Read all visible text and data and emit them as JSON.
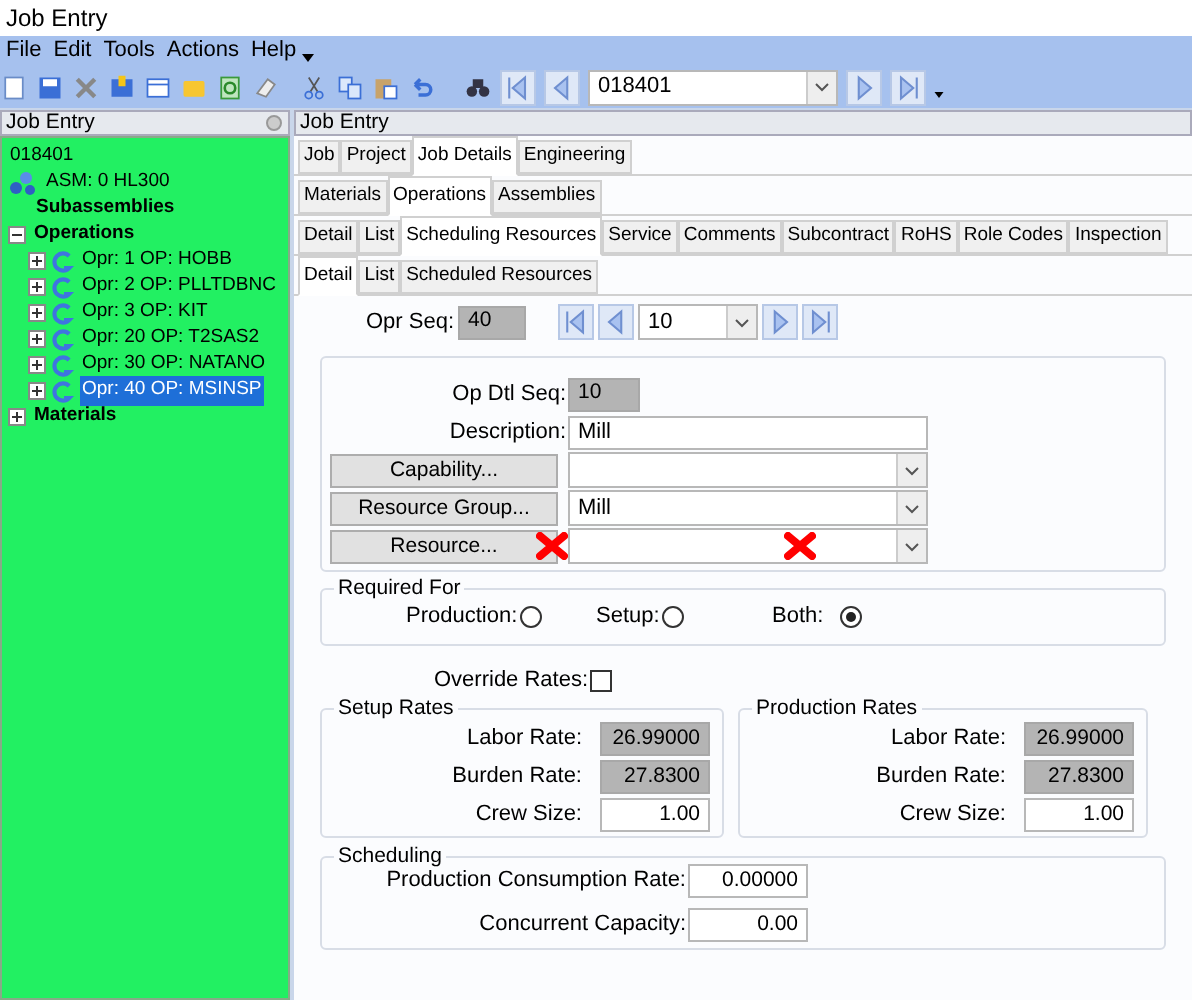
{
  "window": {
    "title": "Job Entry"
  },
  "menu": [
    "File",
    "Edit",
    "Tools",
    "Actions",
    "Help"
  ],
  "toolbar": {
    "record": "018401"
  },
  "tree_panel": {
    "title": "Job Entry",
    "tree": [
      {
        "label": "018401",
        "kind": "root",
        "selected": false,
        "children": [
          {
            "label": "ASM: 0 HL300",
            "kind": "assembly",
            "selected": false
          },
          {
            "label": "Subassemblies",
            "kind": "group",
            "selected": false
          },
          {
            "label": "Operations",
            "kind": "group",
            "expanded": true,
            "selected": false,
            "children": [
              {
                "label": "Opr: 1 OP: HOBB",
                "kind": "operation",
                "expanded": false,
                "selected": false
              },
              {
                "label": "Opr: 2 OP: PLLTDBNC",
                "kind": "operation",
                "expanded": false,
                "selected": false
              },
              {
                "label": "Opr: 3 OP: KIT",
                "kind": "operation",
                "expanded": false,
                "selected": false
              },
              {
                "label": "Opr: 20 OP: T2SAS2",
                "kind": "operation",
                "expanded": false,
                "selected": false
              },
              {
                "label": "Opr: 30 OP: NATANO",
                "kind": "operation",
                "expanded": false,
                "selected": false
              },
              {
                "label": "Opr: 40 OP: MSINSP",
                "kind": "operation",
                "expanded": false,
                "selected": true
              }
            ]
          },
          {
            "label": "Materials",
            "kind": "group",
            "expanded": false,
            "selected": false
          }
        ]
      }
    ]
  },
  "detail_panel": {
    "title": "Job Entry",
    "tab_rows": [
      [
        {
          "label": "Job",
          "selected": false
        },
        {
          "label": "Project",
          "selected": false
        },
        {
          "label": "Job Details",
          "selected": true
        },
        {
          "label": "Engineering",
          "selected": false
        }
      ],
      [
        {
          "label": "Materials",
          "selected": false
        },
        {
          "label": "Operations",
          "selected": true
        },
        {
          "label": "Assemblies",
          "selected": false
        }
      ],
      [
        {
          "label": "Detail",
          "selected": false
        },
        {
          "label": "List",
          "selected": false
        },
        {
          "label": "Scheduling Resources",
          "selected": true
        },
        {
          "label": "Service",
          "selected": false
        },
        {
          "label": "Comments",
          "selected": false
        },
        {
          "label": "Subcontract",
          "selected": false
        },
        {
          "label": "RoHS",
          "selected": false
        },
        {
          "label": "Role Codes",
          "selected": false
        },
        {
          "label": "Inspection",
          "selected": false
        }
      ],
      [
        {
          "label": "Detail",
          "selected": true
        },
        {
          "label": "List",
          "selected": false
        },
        {
          "label": "Scheduled Resources",
          "selected": false
        }
      ]
    ],
    "opr_seq": {
      "label": "Opr Seq:",
      "value": "40"
    },
    "navigator": {
      "value": "10"
    },
    "op_dtl_seq": {
      "label": "Op Dtl Seq:",
      "value": "10"
    },
    "description": {
      "label": "Description:",
      "value": "Mill"
    },
    "lookups": [
      {
        "button": "Capability...",
        "marked": false
      },
      {
        "button": "Resource Group...",
        "value": "Mill",
        "marked": false
      },
      {
        "button": "Resource...",
        "marked": true
      }
    ],
    "required_for": {
      "title": "Required For",
      "options": [
        {
          "label": "Production:",
          "selected": false
        },
        {
          "label": "Setup:",
          "selected": false
        },
        {
          "label": "Both:",
          "selected": true
        }
      ]
    },
    "override_rates": {
      "label": "Override Rates:",
      "checked": false
    },
    "rate_groups": [
      {
        "title": "Setup Rates",
        "rows": [
          {
            "label": "Labor Rate:",
            "value": "26.99000",
            "readonly": true
          },
          {
            "label": "Burden Rate:",
            "value": "27.8300",
            "readonly": true
          },
          {
            "label": "Crew Size:",
            "value": "1.00",
            "readonly": false
          }
        ]
      },
      {
        "title": "Production Rates",
        "rows": [
          {
            "label": "Labor Rate:",
            "value": "26.99000",
            "readonly": true
          },
          {
            "label": "Burden Rate:",
            "value": "27.8300",
            "readonly": true
          },
          {
            "label": "Crew Size:",
            "value": "1.00",
            "readonly": false
          }
        ]
      }
    ],
    "scheduling": {
      "title": "Scheduling",
      "rows": [
        {
          "label": "Production Consumption Rate:",
          "value": "0.00000"
        },
        {
          "label": "Concurrent Capacity:",
          "value": "0.00"
        }
      ]
    }
  }
}
